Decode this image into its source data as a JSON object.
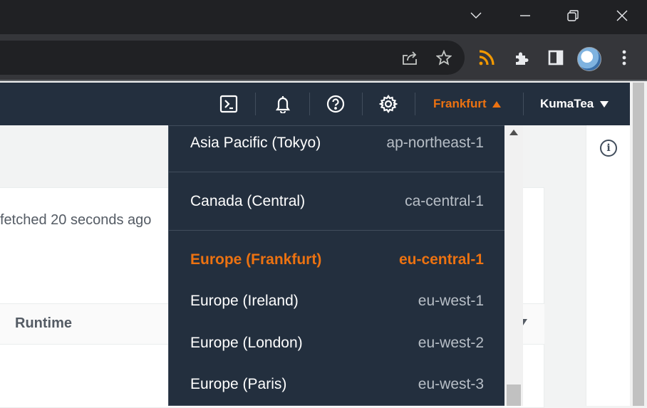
{
  "nav": {
    "region_label": "Frankfurt",
    "user_label": "KumaTea"
  },
  "page": {
    "fetched_text": "fetched 20 seconds ago",
    "table_header_runtime": "Runtime"
  },
  "region_dropdown": {
    "items": [
      {
        "name": "Asia Pacific (Tokyo)",
        "code": "ap-northeast-1",
        "selected": false
      },
      {
        "name": "Canada (Central)",
        "code": "ca-central-1",
        "selected": false
      },
      {
        "name": "Europe (Frankfurt)",
        "code": "eu-central-1",
        "selected": true
      },
      {
        "name": "Europe (Ireland)",
        "code": "eu-west-1",
        "selected": false
      },
      {
        "name": "Europe (London)",
        "code": "eu-west-2",
        "selected": false
      },
      {
        "name": "Europe (Paris)",
        "code": "eu-west-3",
        "selected": false
      }
    ]
  },
  "colors": {
    "nav_bg": "#232f3e",
    "accent": "#ec7211",
    "rss": "#f29900"
  },
  "icons": [
    "chevron-down-icon",
    "minimize-icon",
    "restore-icon",
    "close-icon",
    "share-icon",
    "star-icon",
    "rss-icon",
    "extensions-icon",
    "side-panel-icon",
    "profile-avatar",
    "more-icon",
    "cloudshell-icon",
    "bell-icon",
    "help-icon",
    "settings-icon",
    "info-icon"
  ]
}
